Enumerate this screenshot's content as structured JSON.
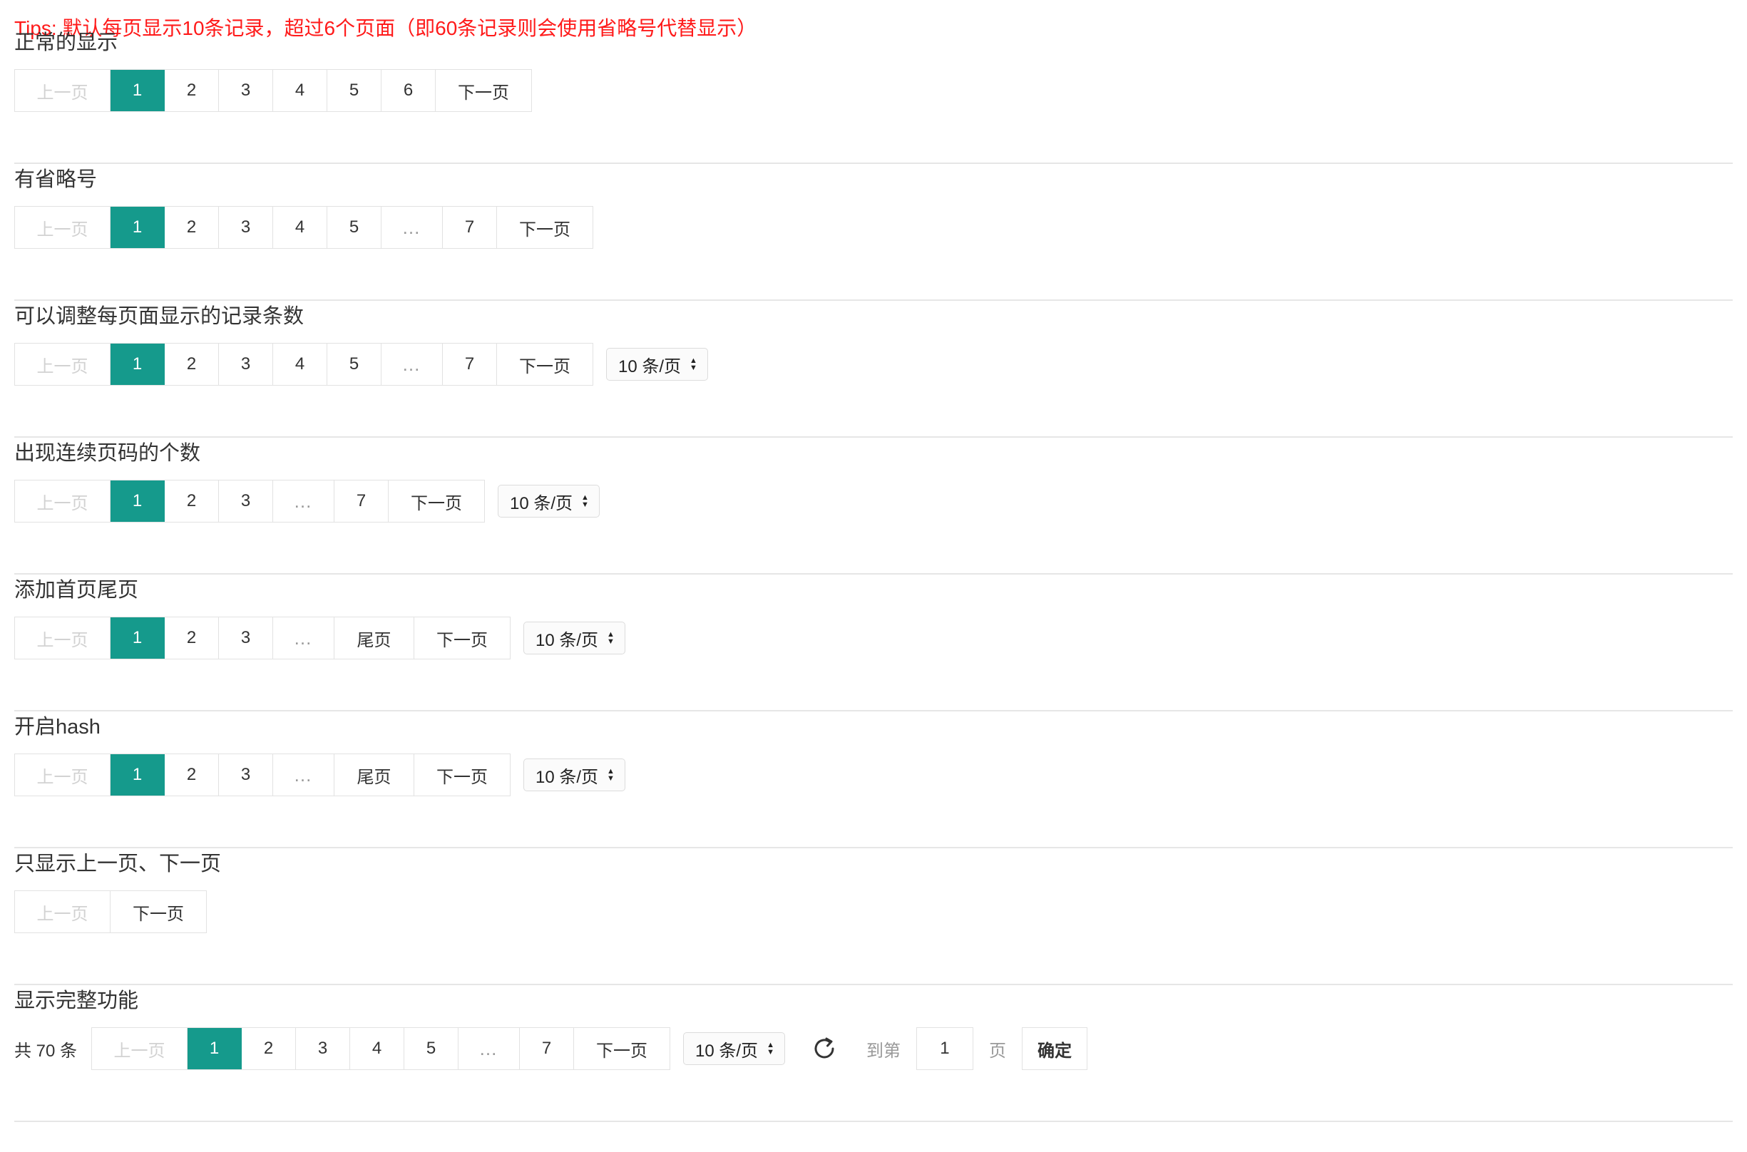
{
  "tips": "Tips: 默认每页显示10条记录，超过6个页面（即60条记录则会使用省略号代替显示）",
  "prev_label": "上一页",
  "next_label": "下一页",
  "last_label": "尾页",
  "ellipsis": "…",
  "limit_label": "10 条/页",
  "accent_color": "#159a8c",
  "tips_color": "#ff1a1a",
  "sections": [
    {
      "title": "正常的显示",
      "pages": [
        "1",
        "2",
        "3",
        "4",
        "5",
        "6"
      ]
    },
    {
      "title": "有省略号",
      "pages": [
        "1",
        "2",
        "3",
        "4",
        "5"
      ],
      "last_page": "7"
    },
    {
      "title": "可以调整每页面显示的记录条数",
      "pages": [
        "1",
        "2",
        "3",
        "4",
        "5"
      ],
      "last_page": "7"
    },
    {
      "title": "出现连续页码的个数",
      "pages": [
        "1",
        "2",
        "3"
      ],
      "last_page": "7"
    },
    {
      "title": "添加首页尾页",
      "pages": [
        "1",
        "2",
        "3"
      ]
    },
    {
      "title": "开启hash",
      "pages": [
        "1",
        "2",
        "3"
      ]
    },
    {
      "title": "只显示上一页、下一页"
    },
    {
      "title": "显示完整功能",
      "pages": [
        "1",
        "2",
        "3",
        "4",
        "5"
      ],
      "last_page": "7",
      "count_label": "共 70 条",
      "skip_label": "到第",
      "skip_value": "1",
      "skip_unit": "页",
      "skip_button": "确定"
    }
  ],
  "icons": {
    "refresh": "refresh-icon",
    "select_arrows": "sort-arrows-icon"
  }
}
